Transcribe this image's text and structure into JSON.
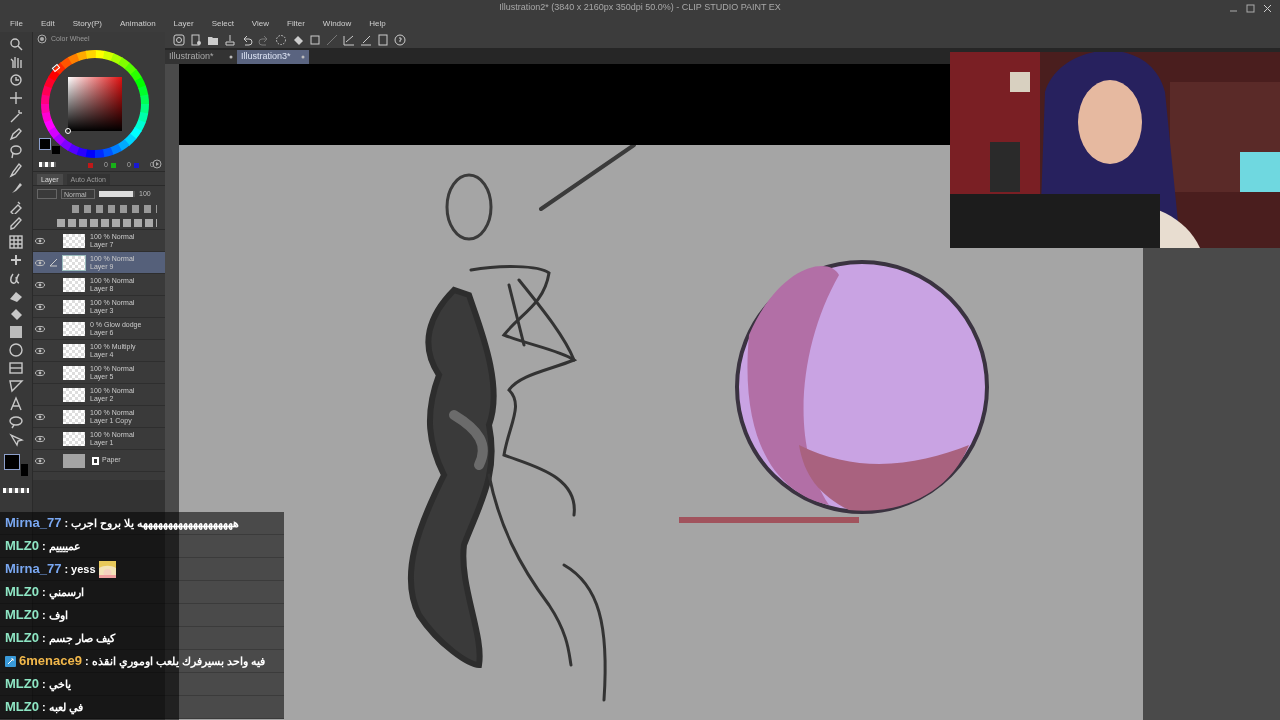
{
  "window": {
    "title": "Illustration2* (3840 x 2160px 350dpi 50.0%) - CLIP STUDIO PAINT EX"
  },
  "menu": [
    "File",
    "Edit",
    "Story(P)",
    "Animation",
    "Layer",
    "Select",
    "View",
    "Filter",
    "Window",
    "Help"
  ],
  "tabs": [
    {
      "label": "Illustration*",
      "selected": false
    },
    {
      "label": "Illustration3*",
      "selected": true
    }
  ],
  "color_wheel": {
    "title": "Color Wheel",
    "rgb": [
      "0",
      "0",
      "0"
    ]
  },
  "layer_panel": {
    "tabs": [
      {
        "label": "Layer",
        "selected": true
      },
      {
        "label": "Auto Action",
        "selected": false
      }
    ],
    "blend_mode": "Normal",
    "opacity": "100",
    "opacity_slider": {
      "level": 0.95
    },
    "layers": [
      {
        "kind": "raster",
        "mode": "100 % Normal",
        "name": "Layer 7",
        "visible": true,
        "selected": false
      },
      {
        "kind": "raster",
        "mode": "100 % Normal",
        "name": "Layer 9",
        "visible": true,
        "selected": true
      },
      {
        "kind": "raster",
        "mode": "100 % Normal",
        "name": "Layer 8",
        "visible": true,
        "selected": false
      },
      {
        "kind": "raster",
        "mode": "100 % Normal",
        "name": "Layer 3",
        "visible": true,
        "selected": false
      },
      {
        "kind": "raster",
        "mode": "0 % Glow dodge",
        "name": "Layer 6",
        "visible": true,
        "selected": false
      },
      {
        "kind": "raster",
        "mode": "100 % Multiply",
        "name": "Layer 4",
        "visible": true,
        "selected": false
      },
      {
        "kind": "raster",
        "mode": "100 % Normal",
        "name": "Layer 5",
        "visible": true,
        "selected": false
      },
      {
        "kind": "raster",
        "mode": "100 % Normal",
        "name": "Layer 2",
        "visible": false,
        "selected": false
      },
      {
        "kind": "raster",
        "mode": "100 % Normal",
        "name": "Layer 1 Copy",
        "visible": true,
        "selected": false
      },
      {
        "kind": "raster",
        "mode": "100 % Normal",
        "name": "Layer 1",
        "visible": true,
        "selected": false
      },
      {
        "kind": "paper",
        "name": "Paper",
        "visible": true,
        "selected": false
      }
    ]
  },
  "chat": [
    {
      "user": "Mirna_77",
      "color": "#7aa8f2",
      "text": ": هههههههههههههههههههه يلا بروح اجرب",
      "badge": false,
      "emote": false
    },
    {
      "user": "MLZ0",
      "color": "#8ee6c4",
      "text": ": عمييييم",
      "badge": false,
      "emote": false
    },
    {
      "user": "Mirna_77",
      "color": "#7aa8f2",
      "text": ": yess",
      "badge": false,
      "emote": true
    },
    {
      "user": "MLZ0",
      "color": "#8ee6c4",
      "text": ": ارسمني",
      "badge": false,
      "emote": false
    },
    {
      "user": "MLZ0",
      "color": "#8ee6c4",
      "text": ": اوف",
      "badge": false,
      "emote": false
    },
    {
      "user": "MLZ0",
      "color": "#8ee6c4",
      "text": ": كيف صار جسم",
      "badge": false,
      "emote": false
    },
    {
      "user": "6menace9",
      "color": "#f2b84b",
      "text": ": فيه واحد بسيرفرك يلعب اوموري انقذه",
      "badge": true,
      "emote": false
    },
    {
      "user": "MLZ0",
      "color": "#8ee6c4",
      "text": ": ياخي",
      "badge": false,
      "emote": false
    },
    {
      "user": "MLZ0",
      "color": "#8ee6c4",
      "text": ": في لعبه",
      "badge": false,
      "emote": false
    }
  ]
}
